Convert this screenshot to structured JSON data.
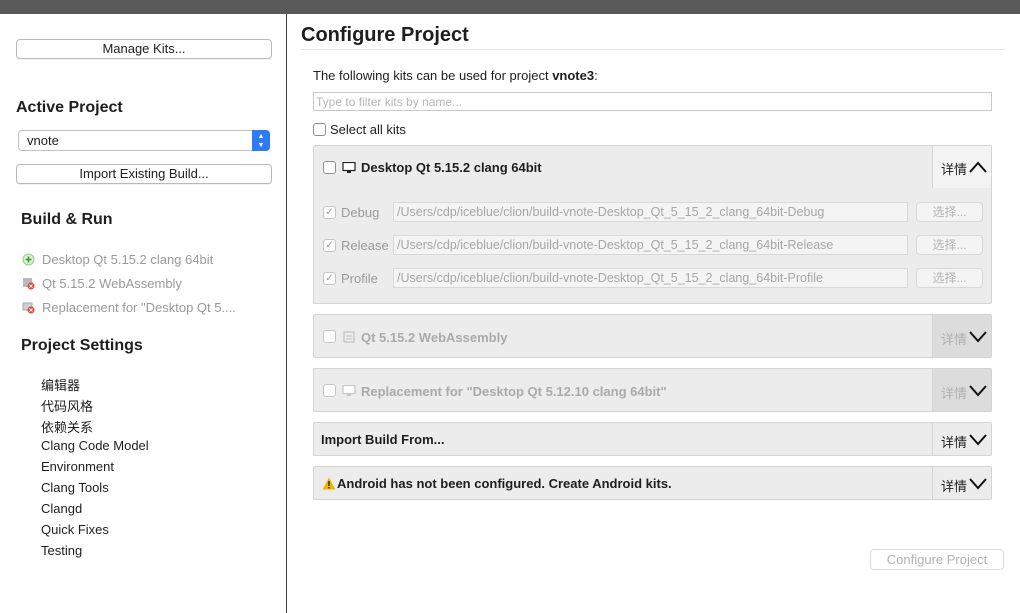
{
  "sidebar": {
    "manage_kits": "Manage Kits...",
    "active_project_heading": "Active Project",
    "project_select_value": "vnote",
    "import_existing_build": "Import Existing Build...",
    "build_run_heading": "Build & Run",
    "build_run_items": [
      {
        "label": "Desktop Qt 5.15.2 clang 64bit",
        "icon": "kit-add-icon"
      },
      {
        "label": "Qt 5.15.2 WebAssembly",
        "icon": "kit-error-icon"
      },
      {
        "label": "Replacement for \"Desktop Qt 5....",
        "icon": "kit-error-icon"
      }
    ],
    "project_settings_heading": "Project Settings",
    "project_settings_items": [
      "编辑器",
      "代码风格",
      "依赖关系",
      "Clang Code Model",
      "Environment",
      "Clang Tools",
      "Clangd",
      "Quick Fixes",
      "Testing"
    ]
  },
  "main": {
    "title": "Configure Project",
    "intro_prefix": "The following kits can be used for project ",
    "intro_project": "vnote3",
    "intro_suffix": ":",
    "filter_placeholder": "Type to filter kits by name...",
    "select_all": "Select all kits",
    "details_label": "详情",
    "choose_label": "选择...",
    "kits": [
      {
        "name": "Desktop Qt 5.15.2 clang 64bit",
        "icon": "desktop-icon",
        "expanded": true,
        "builds": [
          {
            "label": "Debug",
            "path": "/Users/cdp/iceblue/clion/build-vnote-Desktop_Qt_5_15_2_clang_64bit-Debug"
          },
          {
            "label": "Release",
            "path": "/Users/cdp/iceblue/clion/build-vnote-Desktop_Qt_5_15_2_clang_64bit-Release"
          },
          {
            "label": "Profile",
            "path": "/Users/cdp/iceblue/clion/build-vnote-Desktop_Qt_5_15_2_clang_64bit-Profile"
          }
        ]
      },
      {
        "name": "Qt 5.15.2 WebAssembly",
        "icon": "webassembly-icon",
        "disabled": true
      },
      {
        "name": "Replacement for \"Desktop Qt 5.12.10 clang 64bit\"",
        "icon": "desktop-icon",
        "disabled": true
      }
    ],
    "import_build_from": "Import Build From...",
    "android_warning": "Android has not been configured. Create Android kits.",
    "configure_button": "Configure Project"
  },
  "colors": {
    "accent": "#2f7bf5",
    "warning": "#f2b600",
    "top_bar": "#5a5a5a"
  }
}
